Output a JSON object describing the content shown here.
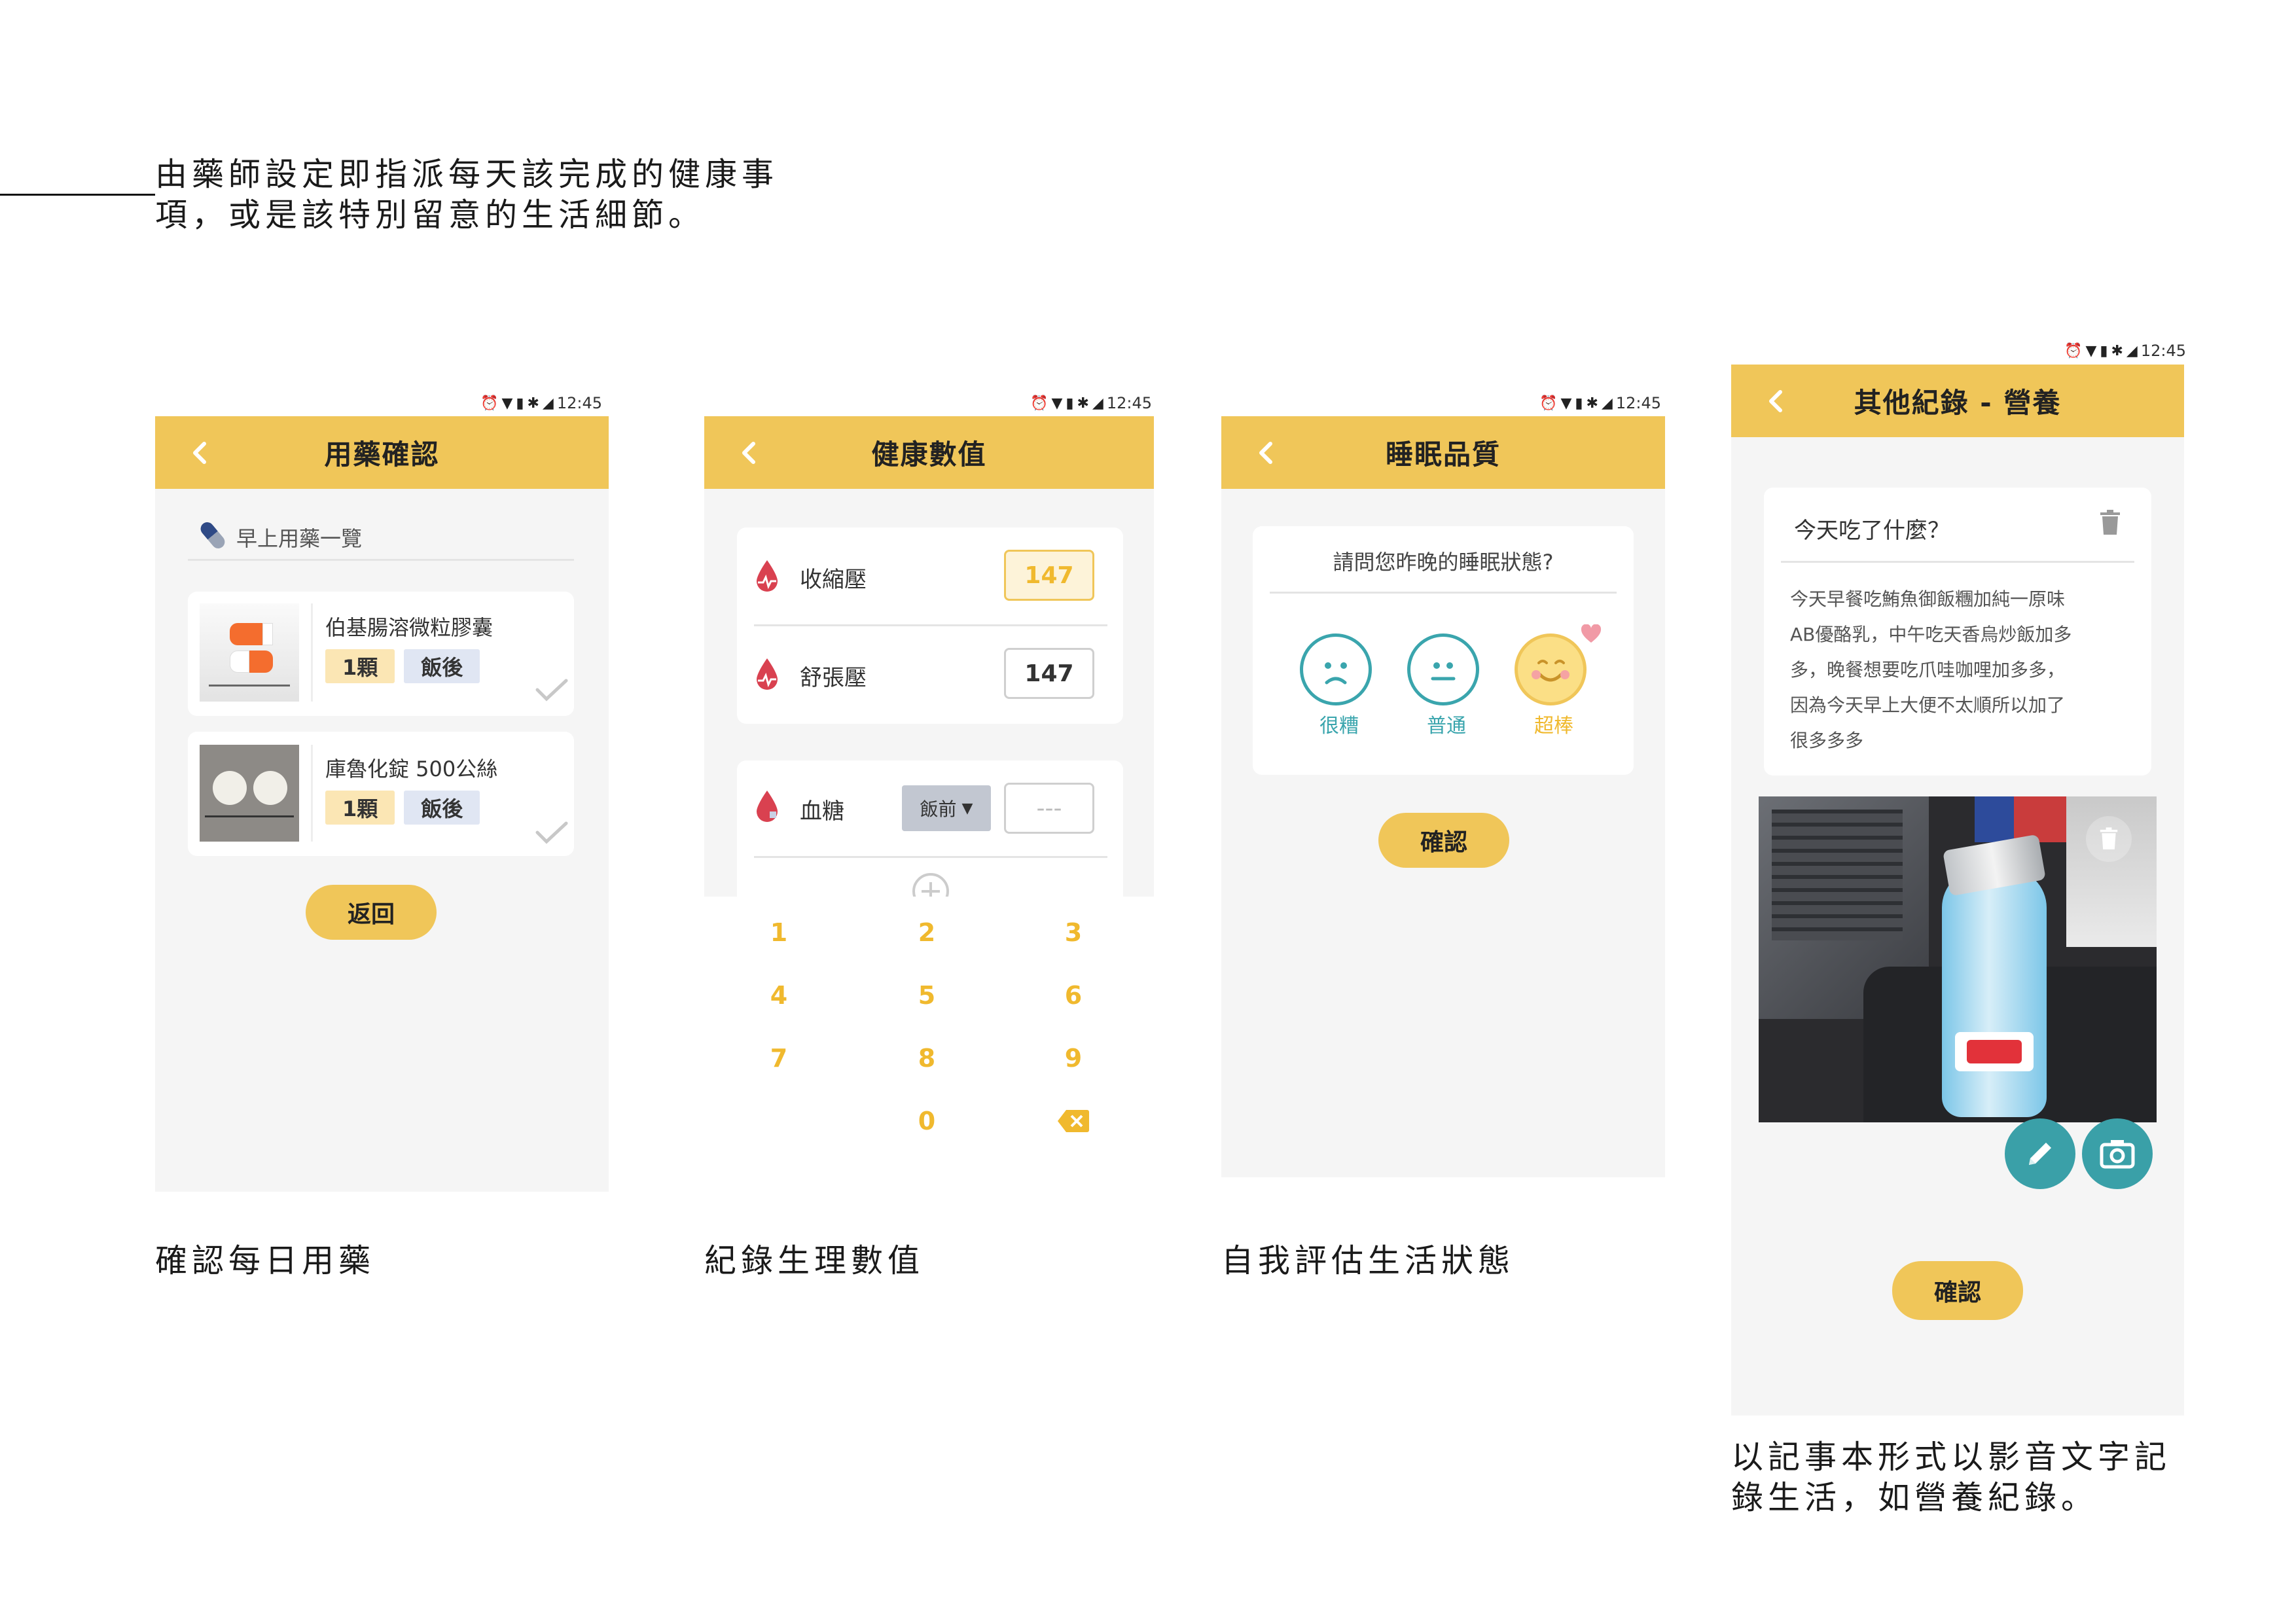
{
  "intro": {
    "text_line1": "由藥師設定即指派每天該完成的健康事",
    "text_line2": "項，或是該特別留意的生活細節。"
  },
  "status_bar": {
    "time": "12:45"
  },
  "screens": {
    "medication": {
      "title": "用藥確認",
      "section_label": "早上用藥一覽",
      "items": [
        {
          "name": "伯基腸溶微粒膠囊",
          "dose": "1顆",
          "timing": "飯後"
        },
        {
          "name": "庫魯化錠 500公絲",
          "dose": "1顆",
          "timing": "飯後"
        }
      ],
      "button_label": "返回",
      "caption": "確認每日用藥"
    },
    "health": {
      "title": "健康數值",
      "systolic_label": "收縮壓",
      "systolic_value": "147",
      "diastolic_label": "舒張壓",
      "diastolic_value": "147",
      "glucose_label": "血糖",
      "glucose_select": "飯前",
      "glucose_placeholder": "---",
      "keypad": [
        "1",
        "2",
        "3",
        "4",
        "5",
        "6",
        "7",
        "8",
        "9",
        "0"
      ],
      "caption": "紀錄生理數值"
    },
    "sleep": {
      "title": "睡眠品質",
      "question": "請問您昨晚的睡眠狀態?",
      "options": [
        "很糟",
        "普通",
        "超棒"
      ],
      "button_label": "確認",
      "caption": "自我評估生活狀態"
    },
    "nutrition": {
      "title": "其他紀錄 - 營養",
      "card_title": "今天吃了什麼？",
      "note_lines": [
        "今天早餐吃鮪魚御飯糰加純一原味",
        "AB優酪乳，中午吃天香烏炒飯加多",
        "多，晚餐想要吃爪哇咖哩加多多，",
        "因為今天早上大便不太順所以加了",
        "很多多多"
      ],
      "button_label": "確認",
      "caption_line1": "以記事本形式以影音文字記",
      "caption_line2": "錄生活，如營養紀錄。"
    }
  },
  "colors": {
    "accent": "#f0c659",
    "teal": "#3aa5ad",
    "blood": "#d94150",
    "screen_bg": "#f5f5f5"
  },
  "icons": [
    "back-chevron-icon",
    "alarm-icon",
    "wifi-icon",
    "battery-icon",
    "bluetooth-icon",
    "signal-icon",
    "pill-icon",
    "checkmark-icon",
    "blood-drop-icon",
    "add-circle-icon",
    "backspace-icon",
    "sad-face-icon",
    "neutral-face-icon",
    "happy-face-icon",
    "heart-icon",
    "trash-icon",
    "pencil-icon",
    "camera-icon"
  ]
}
